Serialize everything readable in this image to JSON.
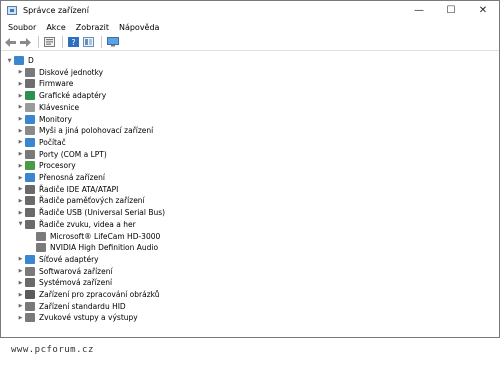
{
  "window": {
    "title": "Správce zařízení",
    "minimize_glyph": "—",
    "maximize_glyph": "☐",
    "close_glyph": "✕"
  },
  "menu": [
    "Soubor",
    "Akce",
    "Zobrazit",
    "Nápověda"
  ],
  "toolbar": {
    "buttons": [
      "back-arrow-icon",
      "forward-arrow-icon",
      "properties-icon",
      "help-icon",
      "view-icon",
      "monitor-icon"
    ]
  },
  "tree": {
    "root": {
      "label": "D",
      "expanded": true
    },
    "categories": [
      {
        "label": "Diskové jednotky",
        "icon": "disk-drive-icon",
        "color": "#7a7a7a",
        "expanded": false
      },
      {
        "label": "Firmware",
        "icon": "firmware-icon",
        "color": "#6e6e6e",
        "expanded": false
      },
      {
        "label": "Grafické adaptéry",
        "icon": "display-adapter-icon",
        "color": "#2f8f4e",
        "expanded": false
      },
      {
        "label": "Klávesnice",
        "icon": "keyboard-icon",
        "color": "#9a9a9a",
        "expanded": false
      },
      {
        "label": "Monitory",
        "icon": "monitor-icon",
        "color": "#3a86d0",
        "expanded": false
      },
      {
        "label": "Myši a jiná polohovací zařízení",
        "icon": "mouse-icon",
        "color": "#8a8a8a",
        "expanded": false
      },
      {
        "label": "Počítač",
        "icon": "computer-icon",
        "color": "#3a86d0",
        "expanded": false
      },
      {
        "label": "Porty (COM a LPT)",
        "icon": "port-icon",
        "color": "#7a7a7a",
        "expanded": false
      },
      {
        "label": "Procesory",
        "icon": "processor-icon",
        "color": "#4a9a4a",
        "expanded": false
      },
      {
        "label": "Přenosná zařízení",
        "icon": "portable-device-icon",
        "color": "#3a86d0",
        "expanded": false
      },
      {
        "label": "Řadiče IDE ATA/ATAPI",
        "icon": "ide-controller-icon",
        "color": "#6a6a6a",
        "expanded": false
      },
      {
        "label": "Řadiče paměťových zařízení",
        "icon": "storage-controller-icon",
        "color": "#6a6a6a",
        "expanded": false
      },
      {
        "label": "Řadiče USB (Universal Serial Bus)",
        "icon": "usb-controller-icon",
        "color": "#6a6a6a",
        "expanded": false
      },
      {
        "label": "Řadiče zvuku, videa a her",
        "icon": "sound-controller-icon",
        "color": "#6a6a6a",
        "expanded": true,
        "children": [
          {
            "label": "Microsoft® LifeCam HD-3000",
            "icon": "audio-device-icon",
            "color": "#7a7a7a"
          },
          {
            "label": "NVIDIA High Definition Audio",
            "icon": "audio-device-icon",
            "color": "#7a7a7a"
          }
        ]
      },
      {
        "label": "Síťové adaptéry",
        "icon": "network-adapter-icon",
        "color": "#3a86d0",
        "expanded": false
      },
      {
        "label": "Softwarová zařízení",
        "icon": "software-device-icon",
        "color": "#7a7a7a",
        "expanded": false
      },
      {
        "label": "Systémová zařízení",
        "icon": "system-device-icon",
        "color": "#6a6a6a",
        "expanded": false
      },
      {
        "label": "Zařízení pro zpracování obrázků",
        "icon": "imaging-device-icon",
        "color": "#5a5a5a",
        "expanded": false
      },
      {
        "label": "Zařízení standardu HID",
        "icon": "hid-device-icon",
        "color": "#7a7a7a",
        "expanded": false
      },
      {
        "label": "Zvukové vstupy a výstupy",
        "icon": "audio-io-icon",
        "color": "#7a7a7a",
        "expanded": false
      }
    ]
  },
  "watermark": "www.pcforum.cz"
}
